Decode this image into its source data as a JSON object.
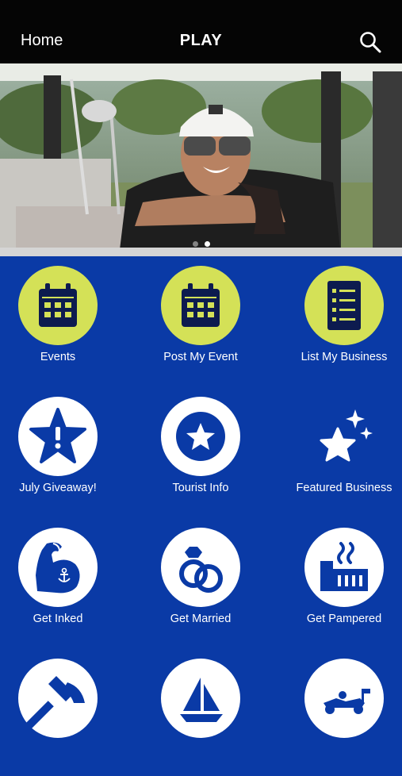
{
  "nav": {
    "home_label": "Home",
    "title": "PLAY",
    "search_icon": "search-icon"
  },
  "hero": {
    "image": "woman in golf cart smiling",
    "slides": 2,
    "active_slide": 2
  },
  "colors": {
    "background": "#0a3aa6",
    "accent": "#d4e157",
    "icon_dark": "#0d1b4f",
    "nav_bg": "#050505"
  },
  "tiles": [
    {
      "label": "Events",
      "icon": "calendar-icon"
    },
    {
      "label": "Post My Event",
      "icon": "calendar-icon"
    },
    {
      "label": "List My Business",
      "icon": "list-document-icon"
    },
    {
      "label": "July Giveaway!",
      "icon": "star-alert-icon"
    },
    {
      "label": "Tourist Info",
      "icon": "star-badge-icon"
    },
    {
      "label": "Featured Business",
      "icon": "sparkle-stars-icon"
    },
    {
      "label": "Get Inked",
      "icon": "tattoo-arm-icon"
    },
    {
      "label": "Get Married",
      "icon": "rings-icon"
    },
    {
      "label": "Get Pampered",
      "icon": "sauna-icon"
    },
    {
      "label": "",
      "icon": "axe-icon"
    },
    {
      "label": "",
      "icon": "sailboat-icon"
    },
    {
      "label": "",
      "icon": "go-kart-icon"
    }
  ]
}
